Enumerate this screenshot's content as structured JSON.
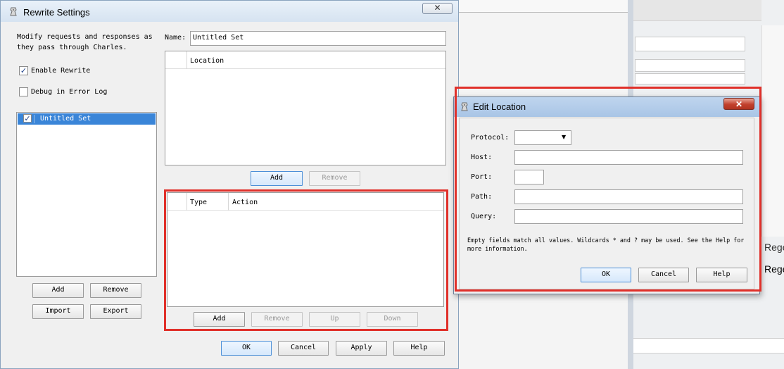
{
  "background": {
    "labels": [
      "Regex",
      "Regex"
    ]
  },
  "rewrite_dialog": {
    "title": "Rewrite Settings",
    "description": "Modify requests and responses as they pass through Charles.",
    "enable_rewrite": {
      "label": "Enable Rewrite",
      "checked": true
    },
    "debug_log": {
      "label": "Debug in Error Log",
      "checked": false
    },
    "sets": [
      {
        "label": "Untitled Set",
        "checked": true,
        "selected": true
      }
    ],
    "set_buttons": {
      "add": "Add",
      "remove": "Remove",
      "import": "Import",
      "export": "Export"
    },
    "name_label": "Name:",
    "name_value": "Untitled Set",
    "location_table": {
      "header": "Location",
      "add": "Add",
      "remove": "Remove"
    },
    "rules_table": {
      "headers": [
        "Type",
        "Action"
      ],
      "add": "Add",
      "remove": "Remove",
      "up": "Up",
      "down": "Down"
    },
    "footer": {
      "ok": "OK",
      "cancel": "Cancel",
      "apply": "Apply",
      "help": "Help"
    },
    "close_glyph": "✕"
  },
  "edit_location_dialog": {
    "title": "Edit Location",
    "close_glyph": "✕",
    "fields": {
      "protocol": {
        "label": "Protocol:",
        "value": ""
      },
      "host": {
        "label": "Host:",
        "value": ""
      },
      "port": {
        "label": "Port:",
        "value": ""
      },
      "path": {
        "label": "Path:",
        "value": ""
      },
      "query": {
        "label": "Query:",
        "value": ""
      }
    },
    "hint_line1": "Empty fields match all values. Wildcards * and ? may be used. See the Help for",
    "hint_line2": "more information.",
    "buttons": {
      "ok": "OK",
      "cancel": "Cancel",
      "help": "Help"
    }
  },
  "colors": {
    "highlight": "#e0302a",
    "selection": "#3a85d8",
    "title_bar_active": "#a9c5e6"
  }
}
